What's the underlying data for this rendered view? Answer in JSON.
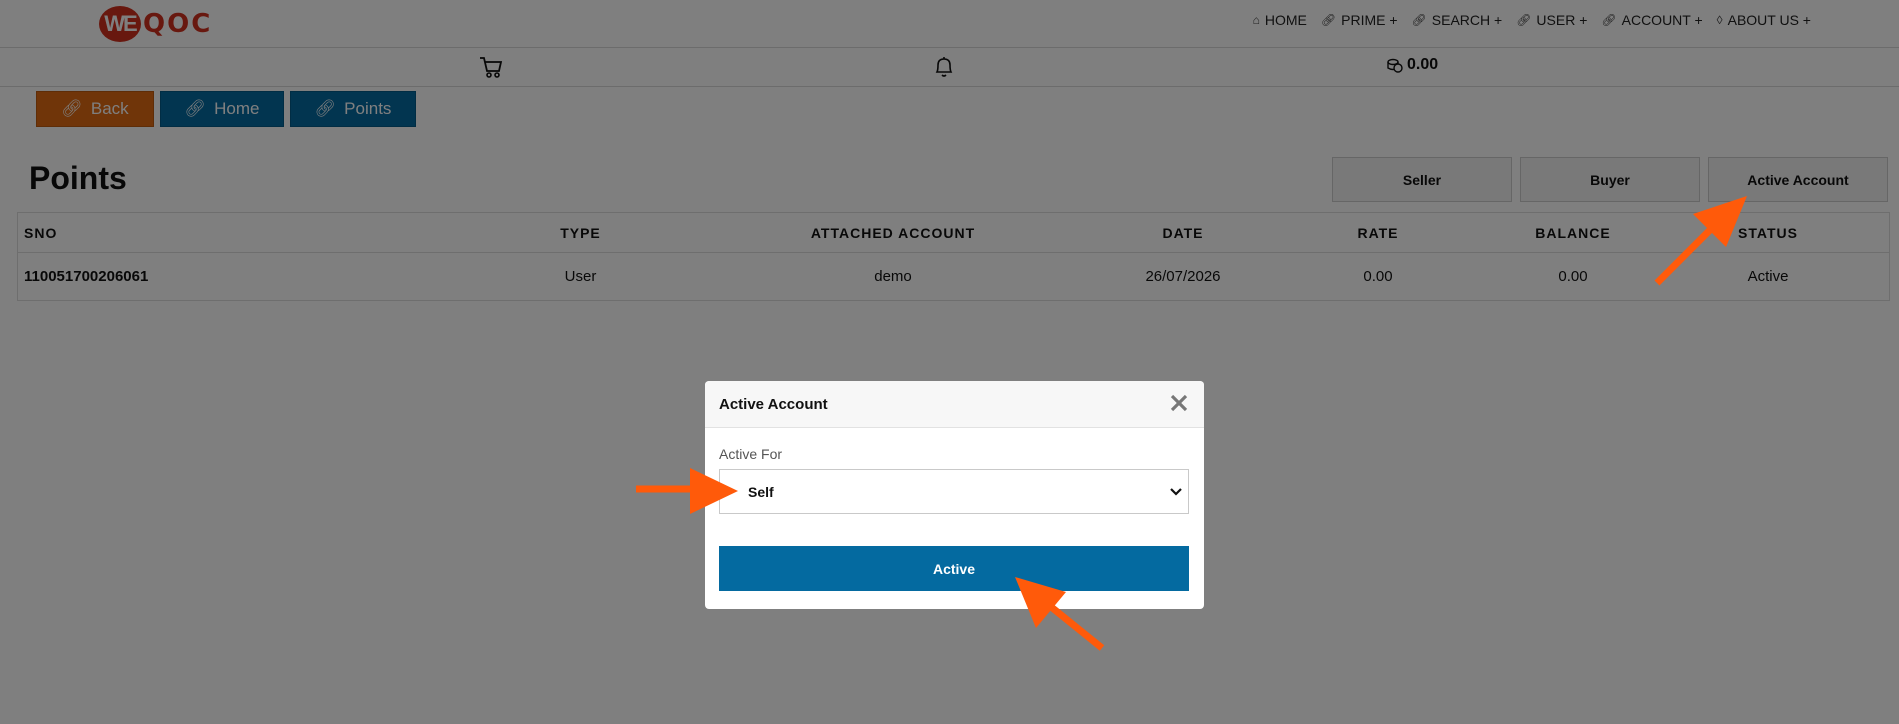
{
  "logo": {
    "mark": "WE",
    "text": "QOC"
  },
  "nav": [
    {
      "label": "HOME",
      "icon": "home-icon"
    },
    {
      "label": "PRIME +",
      "icon": "link-icon"
    },
    {
      "label": "SEARCH +",
      "icon": "link-icon"
    },
    {
      "label": "USER +",
      "icon": "link-icon"
    },
    {
      "label": "ACCOUNT +",
      "icon": "link-icon"
    },
    {
      "label": "ABOUT US +",
      "icon": "drop-icon"
    }
  ],
  "wallet": {
    "amount": "0.00",
    "icon": "coins-icon"
  },
  "actions": {
    "back": "Back",
    "home": "Home",
    "points": "Points"
  },
  "page": {
    "title": "Points"
  },
  "tabs": {
    "seller": "Seller",
    "buyer": "Buyer",
    "active_account": "Active Account"
  },
  "table": {
    "headers": {
      "sno": "SNO",
      "type": "TYPE",
      "attached": "ATTACHED ACCOUNT",
      "date": "DATE",
      "rate": "RATE",
      "balance": "BALANCE",
      "status": "STATUS"
    },
    "rows": [
      {
        "sno": "110051700206061",
        "type": "User",
        "attached": "demo",
        "date": "26/07/2026",
        "rate": "0.00",
        "balance": "0.00",
        "status": "Active"
      }
    ]
  },
  "modal": {
    "title": "Active Account",
    "field_label": "Active For",
    "selected": "Self",
    "submit": "Active"
  },
  "colors": {
    "brand": "#d0301e",
    "primary": "#046aa0",
    "back": "#e06a12",
    "annotation": "#ff5a0a"
  }
}
